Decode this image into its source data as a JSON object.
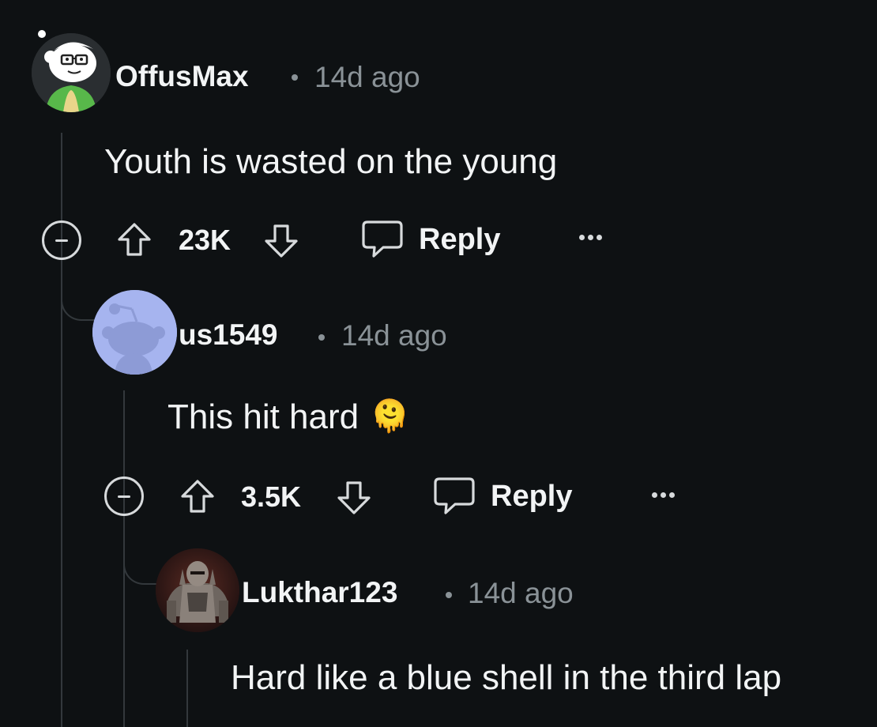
{
  "comments": [
    {
      "username": "OffusMax",
      "time": "14d ago",
      "text": "Youth is wasted on the young",
      "score": "23K",
      "reply_label": "Reply",
      "avatar_icon": "snoo-glasses-avatar-icon"
    },
    {
      "username": "us1549",
      "time": "14d ago",
      "text": "This hit hard",
      "emoji": "🫠",
      "score": "3.5K",
      "reply_label": "Reply",
      "avatar_icon": "default-snoo-avatar-icon"
    },
    {
      "username": "Lukthar123",
      "time": "14d ago",
      "text": "Hard like a blue shell in the third lap",
      "avatar_icon": "armored-figure-avatar-icon"
    }
  ],
  "colors": {
    "background": "#0e1113",
    "text": "#f2f4f5",
    "muted": "#8a9297",
    "thread_line": "#33383c",
    "default_avatar": "#a6b4ef"
  }
}
